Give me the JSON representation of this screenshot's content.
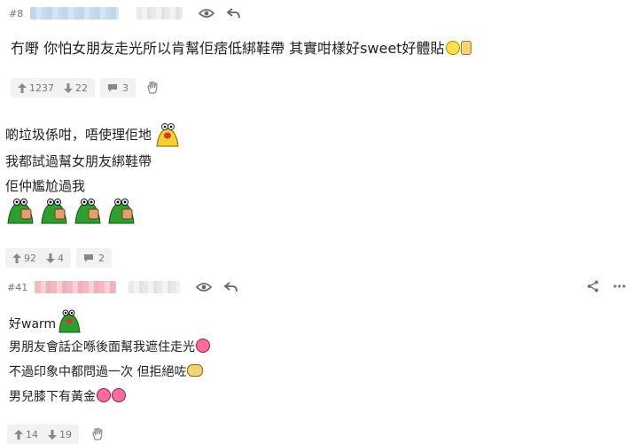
{
  "post1": {
    "number": "#8",
    "text": "冇嘢 你怕女朋友走光所以肯幫佢痞低綁鞋帶 其實咁樣好sweet好體貼",
    "upvotes": "1237",
    "downvotes": "22",
    "comments": "3"
  },
  "post2": {
    "lines": [
      "啲垃圾係咁，唔使理佢地",
      "我都試過幫女朋友綁鞋帶",
      "佢仲尷尬過我"
    ],
    "upvotes": "92",
    "downvotes": "4",
    "comments": "2"
  },
  "post3": {
    "number": "#41",
    "lines": [
      "好warm",
      "男朋友會話企喺後面幫我遮住走光",
      "不過印象中都問過一次 但拒絕咗",
      "男兒膝下有黃金"
    ],
    "upvotes": "14",
    "downvotes": "19"
  },
  "icons": {
    "view": "eye-icon",
    "reply": "reply-arrow-icon",
    "share": "share-icon",
    "more": "more-icon",
    "up": "arrow-up-icon",
    "down": "arrow-down-icon",
    "comment": "comment-bubble-icon",
    "wave": "wave-hand-icon"
  },
  "colors": {
    "accent_blue": "#bfd6ec",
    "accent_pink": "#f3b9c3",
    "pill_bg": "#f2f2f2"
  }
}
